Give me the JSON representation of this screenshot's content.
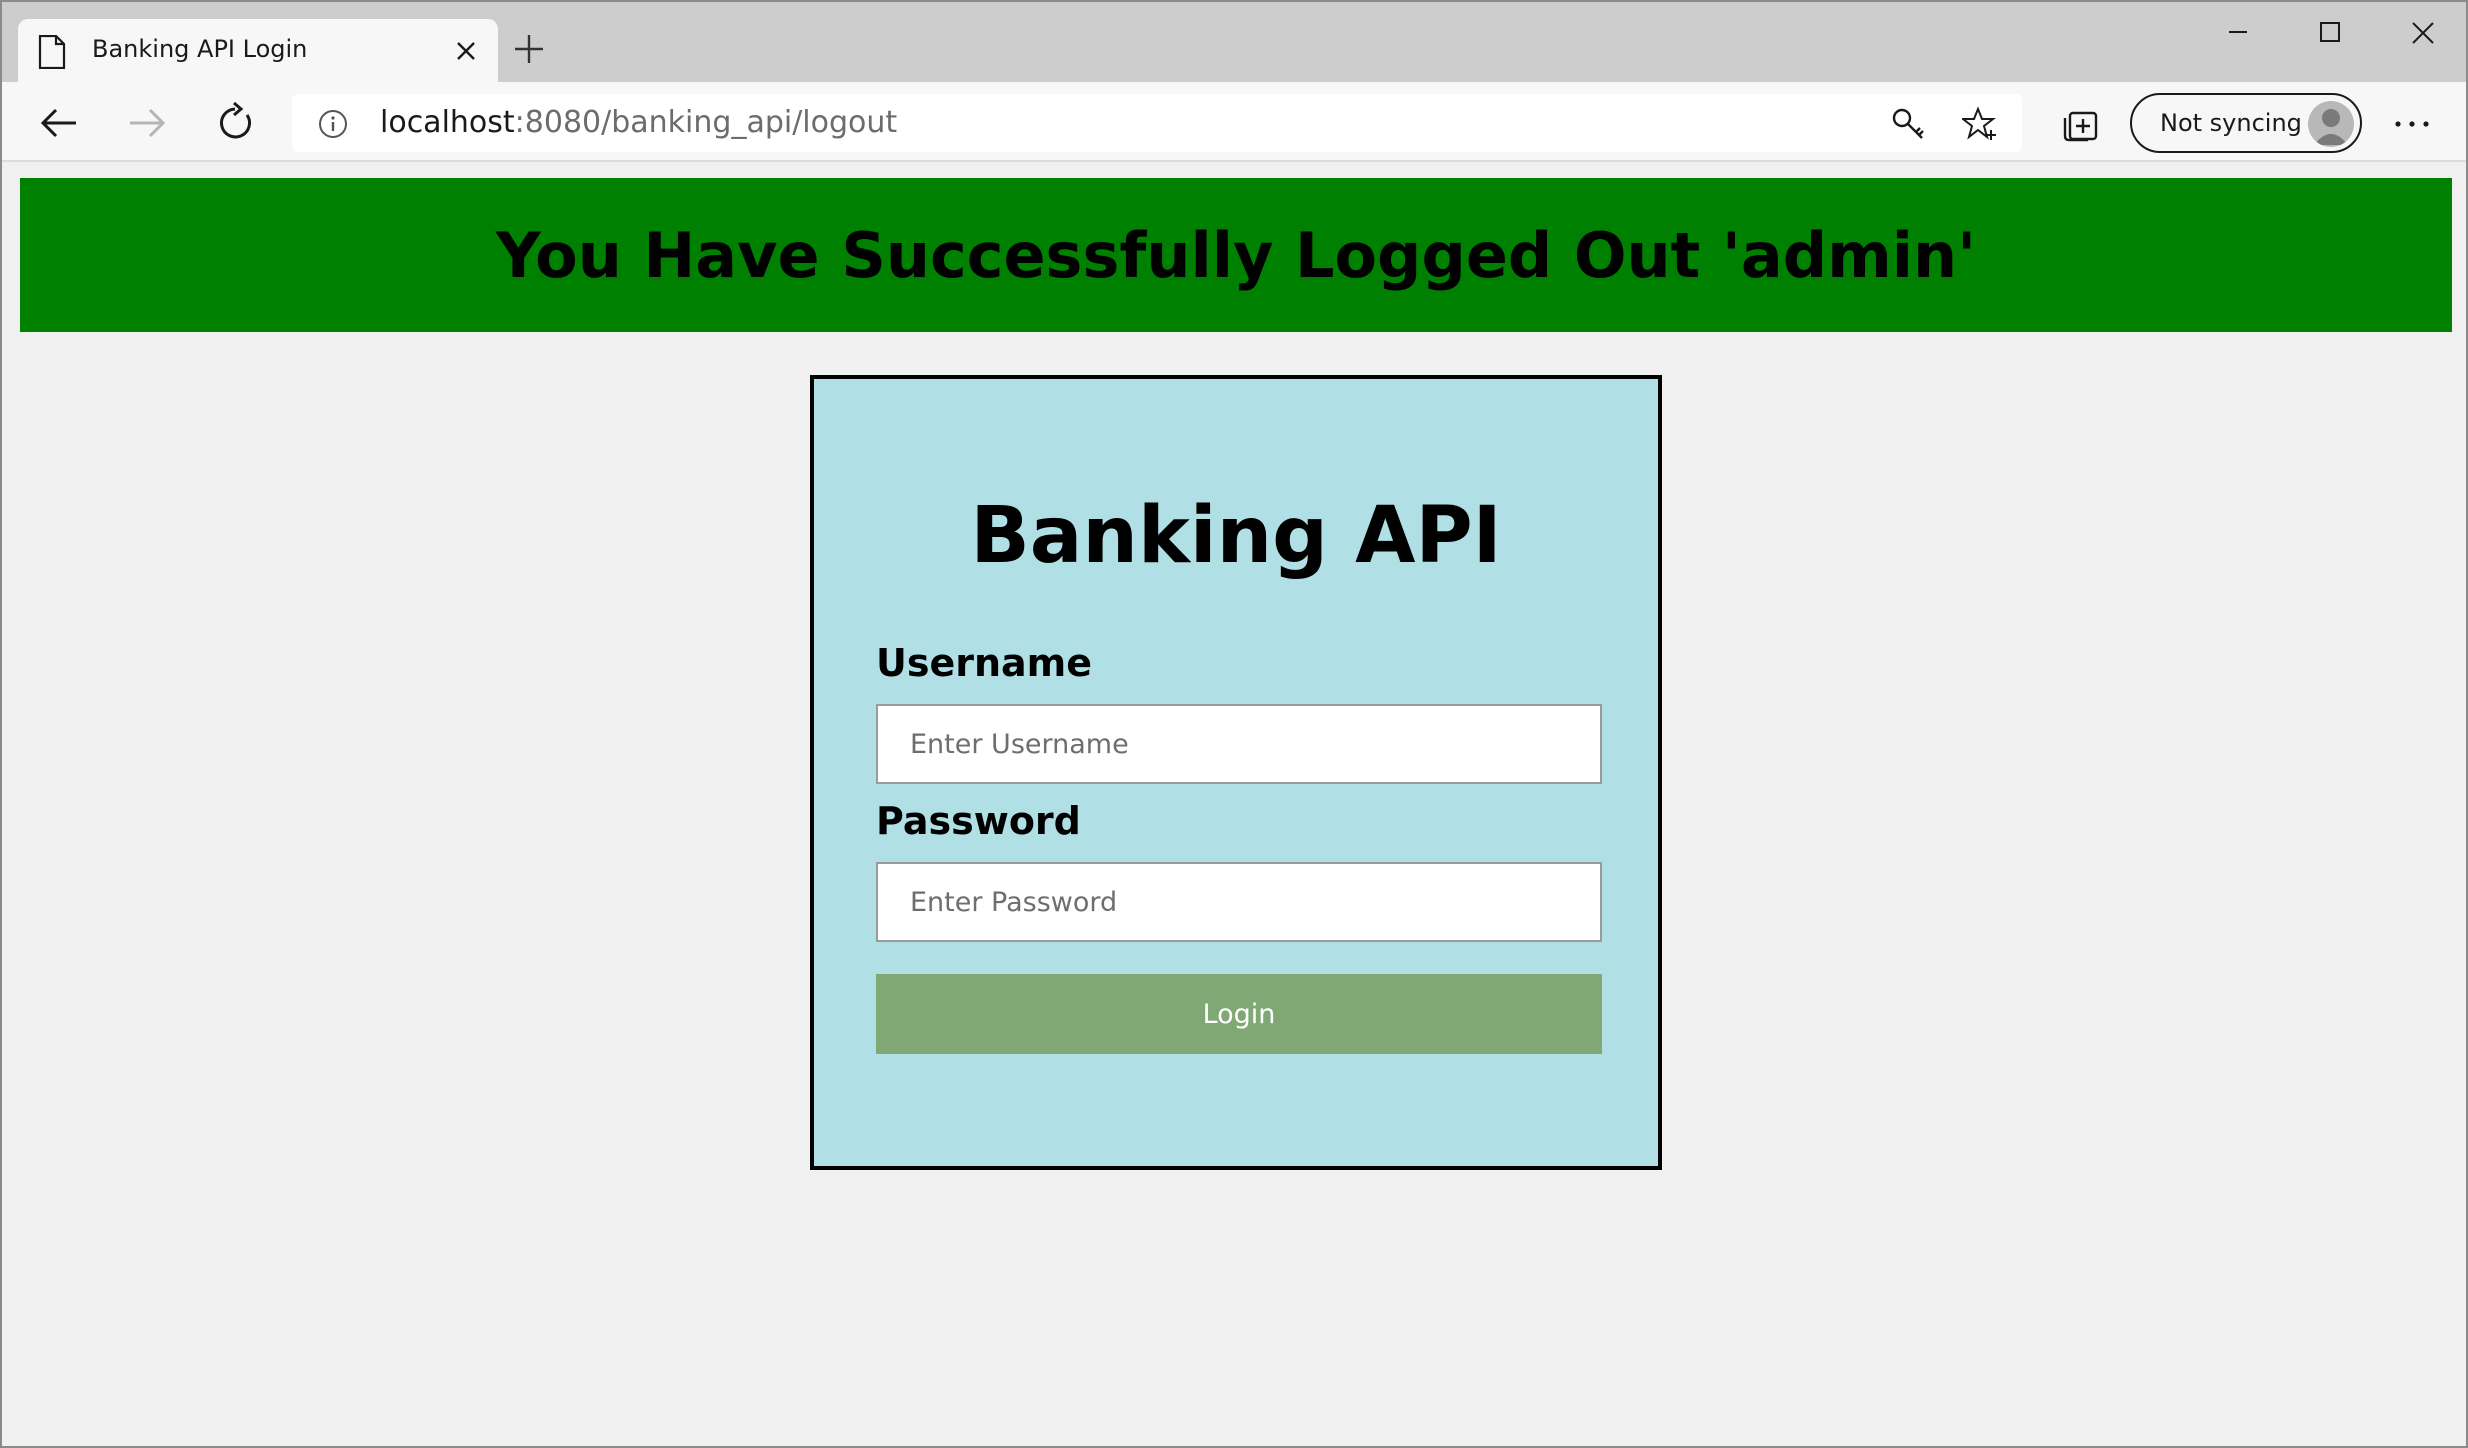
{
  "browser": {
    "tab": {
      "title": "Banking API Login",
      "icon": "page-icon",
      "close_icon": "close-icon"
    },
    "new_tab_icon": "plus-icon",
    "window_controls": [
      "minimize-icon",
      "maximize-icon",
      "close-icon"
    ],
    "address": {
      "host": "localhost",
      "rest": ":8080/banking_api/logout",
      "info_icon": "info-icon"
    },
    "profile": {
      "label": "Not syncing",
      "avatar_icon": "person-icon"
    },
    "more_icon": "ellipsis-icon"
  },
  "banner": {
    "message": "You Have Successfully Logged Out 'admin'",
    "color": "#008000"
  },
  "login": {
    "title": "Banking API",
    "username_label": "Username",
    "username_placeholder": "Enter Username",
    "username_value": "",
    "password_label": "Password",
    "password_placeholder": "Enter Password",
    "password_value": "",
    "button_label": "Login",
    "card_color": "#b0dfe5",
    "button_color": "#80a875"
  }
}
